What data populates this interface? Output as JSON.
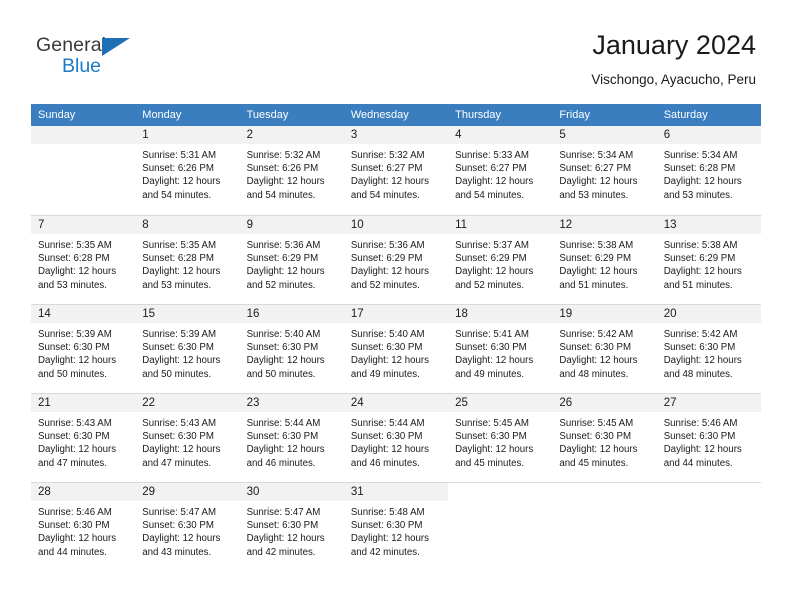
{
  "brand": {
    "name_top": "General",
    "name_bottom": "Blue",
    "accent_color": "#1e7ac4",
    "triangle_color": "#1e6fb5"
  },
  "header": {
    "title": "January 2024",
    "subtitle": "Vischongo, Ayacucho, Peru"
  },
  "calendar": {
    "header_bg": "#3b7ebf",
    "header_text_color": "#ffffff",
    "daynum_bg": "#f2f2f2",
    "weekdays": [
      "Sunday",
      "Monday",
      "Tuesday",
      "Wednesday",
      "Thursday",
      "Friday",
      "Saturday"
    ],
    "weeks": [
      [
        {
          "day": "",
          "empty": true
        },
        {
          "day": "1",
          "sunrise": "Sunrise: 5:31 AM",
          "sunset": "Sunset: 6:26 PM",
          "daylight_1": "Daylight: 12 hours",
          "daylight_2": "and 54 minutes."
        },
        {
          "day": "2",
          "sunrise": "Sunrise: 5:32 AM",
          "sunset": "Sunset: 6:26 PM",
          "daylight_1": "Daylight: 12 hours",
          "daylight_2": "and 54 minutes."
        },
        {
          "day": "3",
          "sunrise": "Sunrise: 5:32 AM",
          "sunset": "Sunset: 6:27 PM",
          "daylight_1": "Daylight: 12 hours",
          "daylight_2": "and 54 minutes."
        },
        {
          "day": "4",
          "sunrise": "Sunrise: 5:33 AM",
          "sunset": "Sunset: 6:27 PM",
          "daylight_1": "Daylight: 12 hours",
          "daylight_2": "and 54 minutes."
        },
        {
          "day": "5",
          "sunrise": "Sunrise: 5:34 AM",
          "sunset": "Sunset: 6:27 PM",
          "daylight_1": "Daylight: 12 hours",
          "daylight_2": "and 53 minutes."
        },
        {
          "day": "6",
          "sunrise": "Sunrise: 5:34 AM",
          "sunset": "Sunset: 6:28 PM",
          "daylight_1": "Daylight: 12 hours",
          "daylight_2": "and 53 minutes."
        }
      ],
      [
        {
          "day": "7",
          "sunrise": "Sunrise: 5:35 AM",
          "sunset": "Sunset: 6:28 PM",
          "daylight_1": "Daylight: 12 hours",
          "daylight_2": "and 53 minutes."
        },
        {
          "day": "8",
          "sunrise": "Sunrise: 5:35 AM",
          "sunset": "Sunset: 6:28 PM",
          "daylight_1": "Daylight: 12 hours",
          "daylight_2": "and 53 minutes."
        },
        {
          "day": "9",
          "sunrise": "Sunrise: 5:36 AM",
          "sunset": "Sunset: 6:29 PM",
          "daylight_1": "Daylight: 12 hours",
          "daylight_2": "and 52 minutes."
        },
        {
          "day": "10",
          "sunrise": "Sunrise: 5:36 AM",
          "sunset": "Sunset: 6:29 PM",
          "daylight_1": "Daylight: 12 hours",
          "daylight_2": "and 52 minutes."
        },
        {
          "day": "11",
          "sunrise": "Sunrise: 5:37 AM",
          "sunset": "Sunset: 6:29 PM",
          "daylight_1": "Daylight: 12 hours",
          "daylight_2": "and 52 minutes."
        },
        {
          "day": "12",
          "sunrise": "Sunrise: 5:38 AM",
          "sunset": "Sunset: 6:29 PM",
          "daylight_1": "Daylight: 12 hours",
          "daylight_2": "and 51 minutes."
        },
        {
          "day": "13",
          "sunrise": "Sunrise: 5:38 AM",
          "sunset": "Sunset: 6:29 PM",
          "daylight_1": "Daylight: 12 hours",
          "daylight_2": "and 51 minutes."
        }
      ],
      [
        {
          "day": "14",
          "sunrise": "Sunrise: 5:39 AM",
          "sunset": "Sunset: 6:30 PM",
          "daylight_1": "Daylight: 12 hours",
          "daylight_2": "and 50 minutes."
        },
        {
          "day": "15",
          "sunrise": "Sunrise: 5:39 AM",
          "sunset": "Sunset: 6:30 PM",
          "daylight_1": "Daylight: 12 hours",
          "daylight_2": "and 50 minutes."
        },
        {
          "day": "16",
          "sunrise": "Sunrise: 5:40 AM",
          "sunset": "Sunset: 6:30 PM",
          "daylight_1": "Daylight: 12 hours",
          "daylight_2": "and 50 minutes."
        },
        {
          "day": "17",
          "sunrise": "Sunrise: 5:40 AM",
          "sunset": "Sunset: 6:30 PM",
          "daylight_1": "Daylight: 12 hours",
          "daylight_2": "and 49 minutes."
        },
        {
          "day": "18",
          "sunrise": "Sunrise: 5:41 AM",
          "sunset": "Sunset: 6:30 PM",
          "daylight_1": "Daylight: 12 hours",
          "daylight_2": "and 49 minutes."
        },
        {
          "day": "19",
          "sunrise": "Sunrise: 5:42 AM",
          "sunset": "Sunset: 6:30 PM",
          "daylight_1": "Daylight: 12 hours",
          "daylight_2": "and 48 minutes."
        },
        {
          "day": "20",
          "sunrise": "Sunrise: 5:42 AM",
          "sunset": "Sunset: 6:30 PM",
          "daylight_1": "Daylight: 12 hours",
          "daylight_2": "and 48 minutes."
        }
      ],
      [
        {
          "day": "21",
          "sunrise": "Sunrise: 5:43 AM",
          "sunset": "Sunset: 6:30 PM",
          "daylight_1": "Daylight: 12 hours",
          "daylight_2": "and 47 minutes."
        },
        {
          "day": "22",
          "sunrise": "Sunrise: 5:43 AM",
          "sunset": "Sunset: 6:30 PM",
          "daylight_1": "Daylight: 12 hours",
          "daylight_2": "and 47 minutes."
        },
        {
          "day": "23",
          "sunrise": "Sunrise: 5:44 AM",
          "sunset": "Sunset: 6:30 PM",
          "daylight_1": "Daylight: 12 hours",
          "daylight_2": "and 46 minutes."
        },
        {
          "day": "24",
          "sunrise": "Sunrise: 5:44 AM",
          "sunset": "Sunset: 6:30 PM",
          "daylight_1": "Daylight: 12 hours",
          "daylight_2": "and 46 minutes."
        },
        {
          "day": "25",
          "sunrise": "Sunrise: 5:45 AM",
          "sunset": "Sunset: 6:30 PM",
          "daylight_1": "Daylight: 12 hours",
          "daylight_2": "and 45 minutes."
        },
        {
          "day": "26",
          "sunrise": "Sunrise: 5:45 AM",
          "sunset": "Sunset: 6:30 PM",
          "daylight_1": "Daylight: 12 hours",
          "daylight_2": "and 45 minutes."
        },
        {
          "day": "27",
          "sunrise": "Sunrise: 5:46 AM",
          "sunset": "Sunset: 6:30 PM",
          "daylight_1": "Daylight: 12 hours",
          "daylight_2": "and 44 minutes."
        }
      ],
      [
        {
          "day": "28",
          "sunrise": "Sunrise: 5:46 AM",
          "sunset": "Sunset: 6:30 PM",
          "daylight_1": "Daylight: 12 hours",
          "daylight_2": "and 44 minutes."
        },
        {
          "day": "29",
          "sunrise": "Sunrise: 5:47 AM",
          "sunset": "Sunset: 6:30 PM",
          "daylight_1": "Daylight: 12 hours",
          "daylight_2": "and 43 minutes."
        },
        {
          "day": "30",
          "sunrise": "Sunrise: 5:47 AM",
          "sunset": "Sunset: 6:30 PM",
          "daylight_1": "Daylight: 12 hours",
          "daylight_2": "and 42 minutes."
        },
        {
          "day": "31",
          "sunrise": "Sunrise: 5:48 AM",
          "sunset": "Sunset: 6:30 PM",
          "daylight_1": "Daylight: 12 hours",
          "daylight_2": "and 42 minutes."
        },
        {
          "day": "",
          "empty": true,
          "blank": true
        },
        {
          "day": "",
          "empty": true,
          "blank": true
        },
        {
          "day": "",
          "empty": true,
          "blank": true
        }
      ]
    ]
  }
}
